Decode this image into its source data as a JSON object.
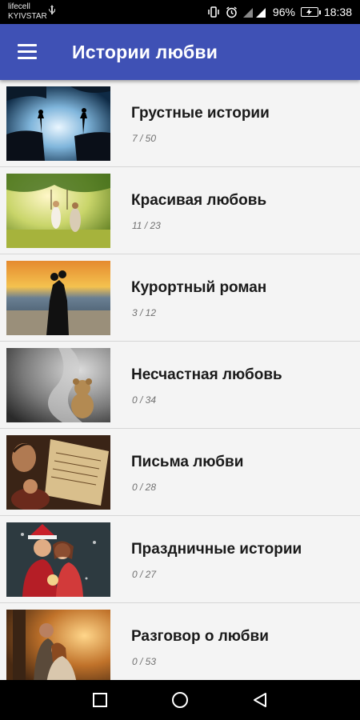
{
  "status_bar": {
    "carrier_1": "lifecell",
    "carrier_2": "KYIVSTAR",
    "battery_percent": "96%",
    "time": "18:38",
    "icons": [
      "usb-icon",
      "vibrate-icon",
      "alarm-icon",
      "signal-icon",
      "battery-icon"
    ]
  },
  "app_bar": {
    "title": "Истории любви",
    "menu_icon": "hamburger-menu-icon",
    "color": "#3f51b5"
  },
  "categories": [
    {
      "title": "Грустные истории",
      "count": "7 / 50"
    },
    {
      "title": "Красивая любовь",
      "count": "11 / 23"
    },
    {
      "title": "Курортный роман",
      "count": "3 / 12"
    },
    {
      "title": "Несчастная любовь",
      "count": "0 / 34"
    },
    {
      "title": "Письма любви",
      "count": "0 / 28"
    },
    {
      "title": "Праздничные истории",
      "count": "0 / 27"
    },
    {
      "title": "Разговор о любви",
      "count": "0 / 53"
    }
  ],
  "nav_bar": {
    "icons": [
      "recent-apps-icon",
      "home-icon",
      "back-icon"
    ]
  }
}
